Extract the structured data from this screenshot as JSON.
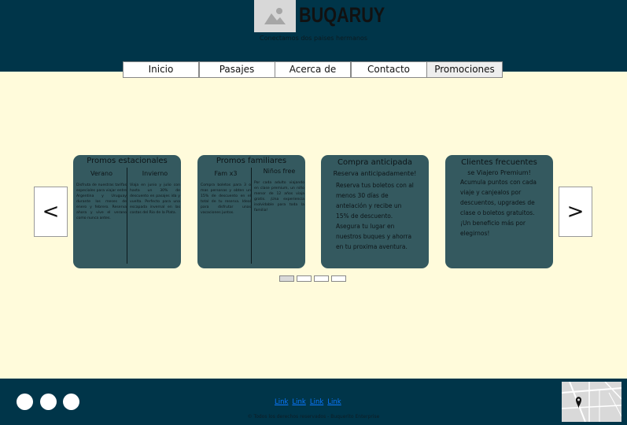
{
  "header": {
    "brand": "BUQARUY",
    "tagline": "Conectamos dos paises hermanos",
    "logo_icon": "image-placeholder-icon",
    "bg_color": "#003549"
  },
  "nav": {
    "items": [
      {
        "label": "Inicio"
      },
      {
        "label": "Pasajes"
      },
      {
        "label": "Acerca de"
      },
      {
        "label": "Contacto"
      },
      {
        "label": "Promociones"
      }
    ],
    "active": "Promociones"
  },
  "carousel": {
    "prev_label": "<",
    "next_label": ">",
    "cards": [
      {
        "title": "Promos estacionales",
        "left_head": "Verano",
        "left_text": "Disfruta de nuestras tarifas especiales para viajar entre Argentina y Uruguay durante los meses de enero y febrero. Reserva ahora y vive el verano como nunca antes.",
        "right_head": "Invierno",
        "right_text": "Viaja en junio y julio con hasta un 30% de descuento en pasajes ida y vuelta. Perfecto para una escapada invernal en las costas del Rio de la Plata."
      },
      {
        "title": "Promos familiares",
        "left_head": "Fam x3",
        "left_text": "Compra boletos para 3 o mas personas y obten un 15% de descuento en el total de tu reserva. Ideal para disfrutar unas vacaciones juntos.",
        "right_head": "Niños free",
        "right_text": "Por cada adulto viajando en clase premium, un niño menor de 12 años viaja gratis. ¡Una experiencia inolvidable para toda la familia!"
      },
      {
        "title": "Compra anticipada",
        "subtitle": "Reserva anticipadamente!",
        "text": "Reserva tus boletos con al menos 30 días de antelación y recibe un 15% de descuento. Asegura tu lugar en nuestros buques y ahorra en tu proxima aventura."
      },
      {
        "title": "Clientes frecuentes",
        "subtitle": "se Viajero Premium!",
        "text": "Acumula puntos con cada viaje y canjealos por descuentos, upgrades de clase o boletos gratuitos. ¡Un beneficio más por elegirnos!"
      }
    ],
    "card_color": "#34595f",
    "dots_count": 4,
    "active_dot": 1
  },
  "footer": {
    "links": [
      "Link",
      "Link",
      "Link",
      "Link"
    ],
    "copyright": "© Todos los derechos reservados - Buquerito Enterprise",
    "social_icons": [
      "social-icon-1",
      "social-icon-2",
      "social-icon-3"
    ],
    "map_icon": "map-location-icon"
  }
}
